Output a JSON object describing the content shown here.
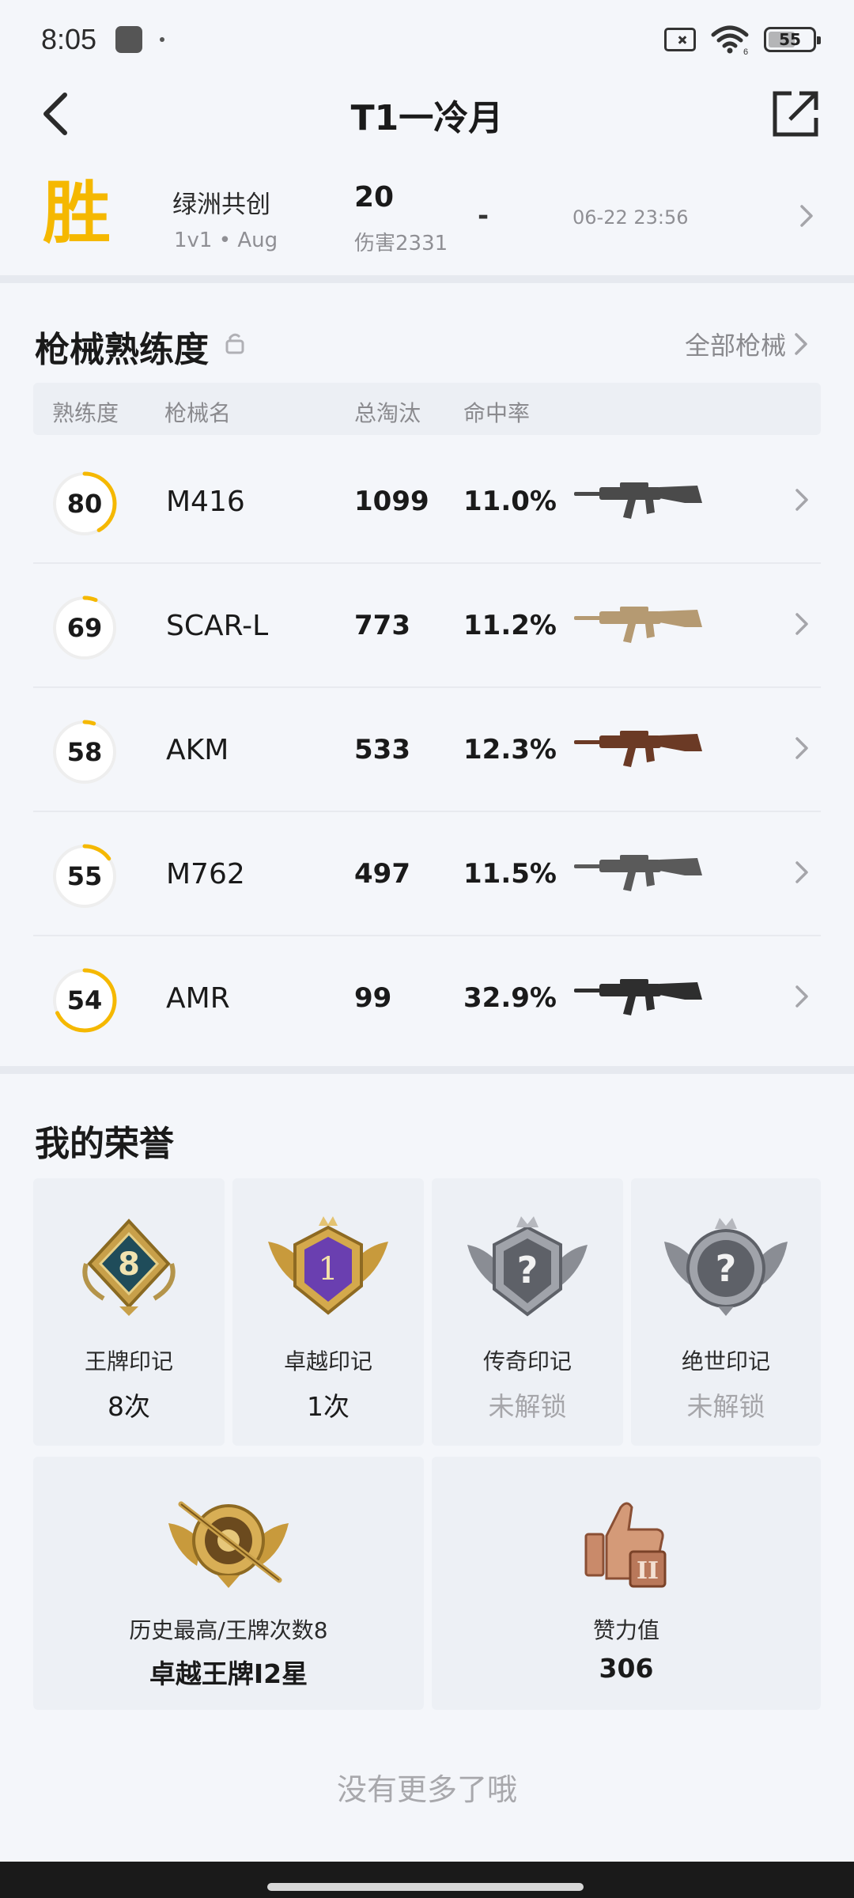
{
  "status_bar": {
    "time": "8:05",
    "battery": "55",
    "wifi_sub": "6"
  },
  "header": {
    "title": "T1一冷月"
  },
  "match": {
    "result": "胜",
    "mode": "绿洲共创",
    "sub": "1v1 • Aug",
    "kills": "20",
    "damage": "伤害2331",
    "dash": "-",
    "time": "06-22 23:56"
  },
  "weapons": {
    "title": "枪械熟练度",
    "all_label": "全部枪械",
    "columns": [
      "熟练度",
      "枪械名",
      "总淘汰",
      "命中率"
    ],
    "rows": [
      {
        "level": "80",
        "name": "M416",
        "kills": "1099",
        "rate": "11.0%",
        "progress": 0.42,
        "color": "#4a4a4a"
      },
      {
        "level": "69",
        "name": "SCAR-L",
        "kills": "773",
        "rate": "11.2%",
        "progress": 0.06,
        "color": "#b59a72"
      },
      {
        "level": "58",
        "name": "AKM",
        "kills": "533",
        "rate": "12.3%",
        "progress": 0.05,
        "color": "#6b3a25"
      },
      {
        "level": "55",
        "name": "M762",
        "kills": "497",
        "rate": "11.5%",
        "progress": 0.15,
        "color": "#5a5a5a"
      },
      {
        "level": "54",
        "name": "AMR",
        "kills": "99",
        "rate": "32.9%",
        "progress": 0.68,
        "color": "#2e2e2e"
      }
    ]
  },
  "honors": {
    "title": "我的荣誉",
    "cards": [
      {
        "label": "王牌印记",
        "value": "8次",
        "locked": false,
        "badge_num": "8"
      },
      {
        "label": "卓越印记",
        "value": "1次",
        "locked": false,
        "badge_num": "1"
      },
      {
        "label": "传奇印记",
        "value": "未解锁",
        "locked": true,
        "badge_num": "?"
      },
      {
        "label": "绝世印记",
        "value": "未解锁",
        "locked": true,
        "badge_num": "?"
      }
    ],
    "highest": {
      "label": "历史最高/王牌次数8",
      "value": "卓越王牌I2星"
    },
    "likes": {
      "label": "赞力值",
      "value": "306",
      "badge": "II"
    }
  },
  "footer": {
    "end_text": "没有更多了哦"
  },
  "colors": {
    "accent": "#f5b800",
    "ring_track": "#eeeeee",
    "muted": "#8a8a8e"
  }
}
